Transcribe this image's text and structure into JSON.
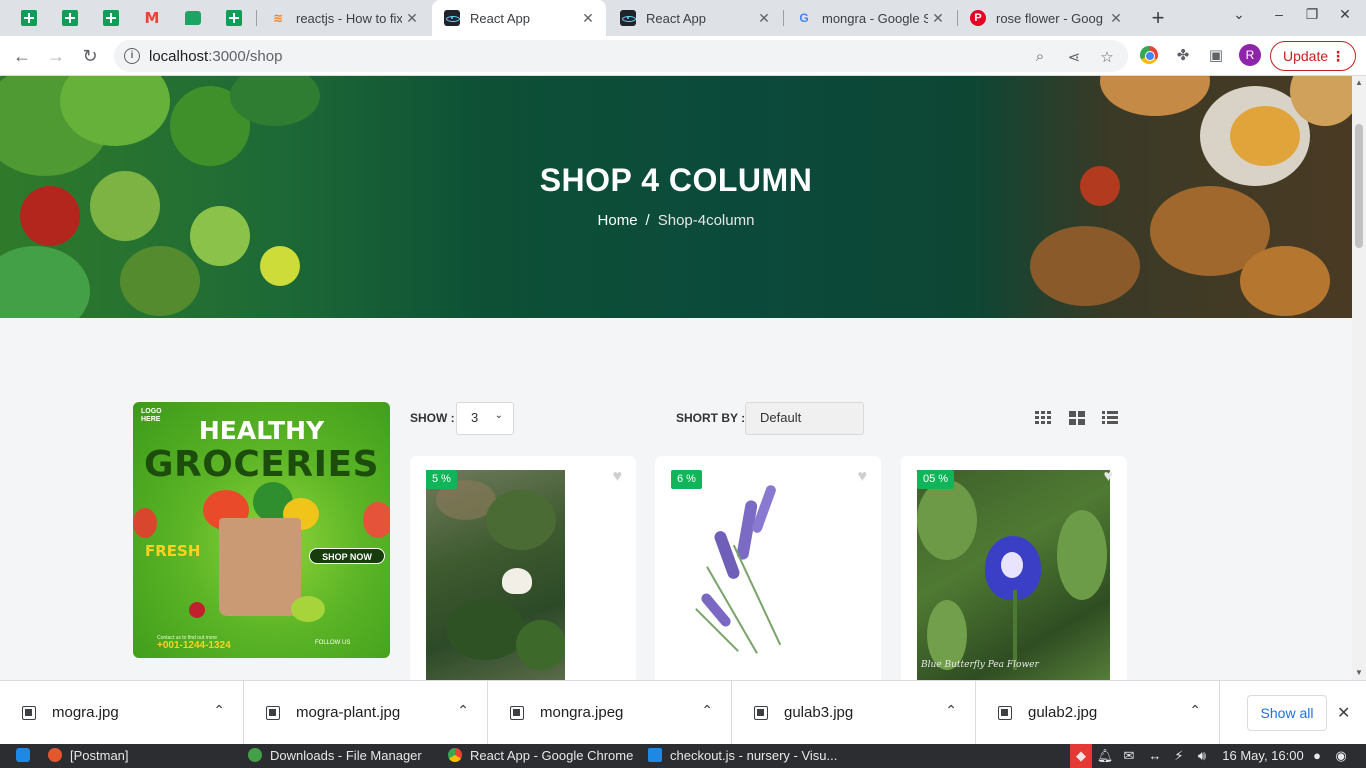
{
  "browser": {
    "tabs": [
      {
        "title": "reactjs - How to fix",
        "icon": "stackoverflow-icon"
      },
      {
        "title": "React App",
        "icon": "react-icon",
        "active": true
      },
      {
        "title": "React App",
        "icon": "react-icon"
      },
      {
        "title": "mongra - Google S",
        "icon": "google-icon"
      },
      {
        "title": "rose flower - Goog",
        "icon": "pinterest-icon"
      }
    ],
    "pinned_tabs": [
      "sheets-icon",
      "sheets-icon",
      "sheets-icon",
      "gmail-icon",
      "chat-icon",
      "sheets-icon"
    ],
    "url_host": "localhost",
    "url_path": ":3000/shop",
    "profile_initial": "R",
    "update_label": "Update"
  },
  "hero": {
    "title": "SHOP 4 COLUMN",
    "breadcrumb_home": "Home",
    "breadcrumb_sep": "/",
    "breadcrumb_current": "Shop-4column"
  },
  "banner": {
    "logo_line1": "LOGO",
    "logo_line2": "HERE",
    "heading1": "HEALTHY",
    "heading2": "GROCERIES",
    "fresh": "FRESH",
    "cta": "SHOP NOW",
    "contact": "Contact us to find out more",
    "phone": "+001-1244-1324",
    "follow": "FOLLOW US"
  },
  "shop": {
    "show_label": "SHOW :",
    "show_value": "3",
    "sort_label": "SHORT BY :",
    "sort_value": "Default",
    "products": [
      {
        "badge": "5 %",
        "image": "magnolia-flower"
      },
      {
        "badge": "6 %",
        "image": "lavender-flower"
      },
      {
        "badge": "05 %",
        "image": "blue-butterfly-pea-flower",
        "caption": "Blue Butterfly Pea Flower"
      }
    ]
  },
  "downloads": {
    "files": [
      "mogra.jpg",
      "mogra-plant.jpg",
      "mongra.jpeg",
      "gulab3.jpg",
      "gulab2.jpg"
    ],
    "show_all": "Show all"
  },
  "taskbar": {
    "items": [
      "[Postman]",
      "Downloads - File Manager",
      "React App - Google Chrome",
      "checkout.js - nursery - Visu..."
    ],
    "clock": "16 May, 16:00"
  },
  "colors": {
    "accent_green": "#10b55a",
    "hero_dark": "#0b4a3b",
    "update_red": "#c5221f"
  }
}
